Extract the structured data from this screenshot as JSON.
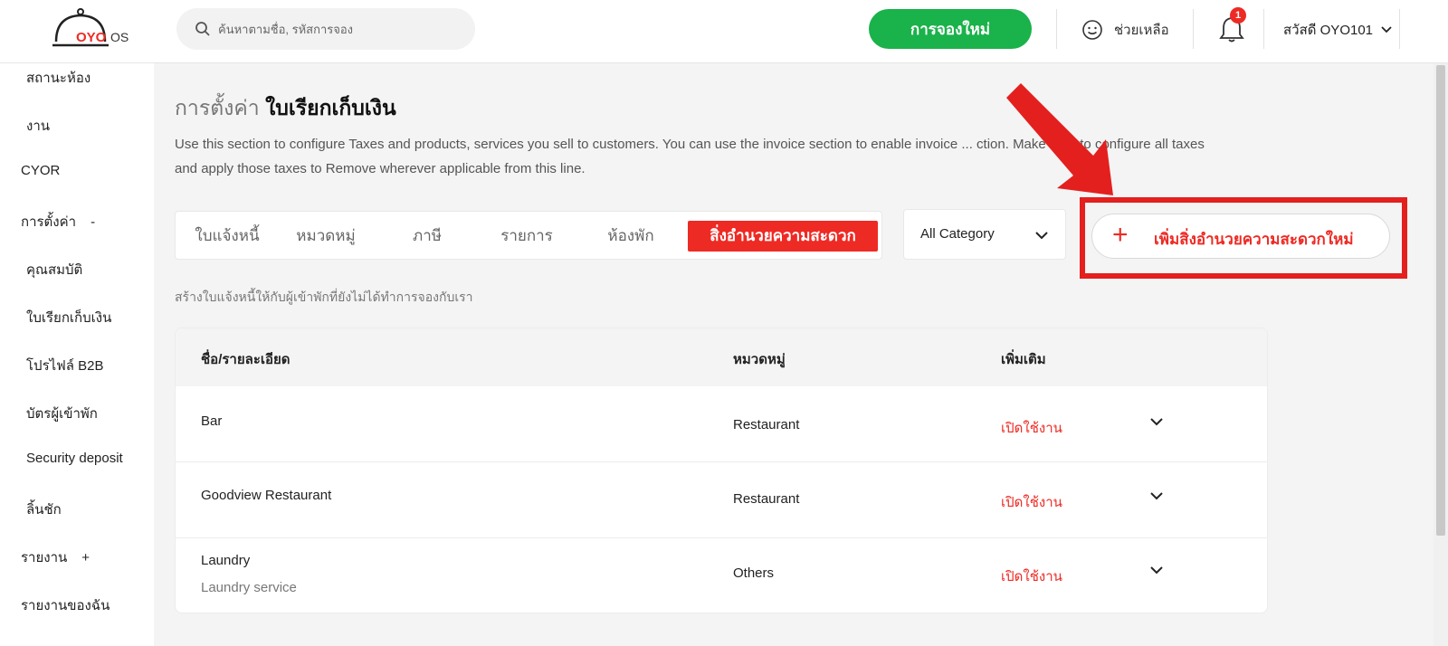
{
  "header": {
    "logo_text": "OYO",
    "logo_suffix": "OS",
    "search_placeholder": "ค้นหาตามชื่อ, รหัสการจอง",
    "new_booking_label": "การจองใหม่",
    "help_label": "ช่วยเหลือ",
    "notification_count": "1",
    "user_greeting": "สวัสดี OYO101"
  },
  "sidebar": {
    "items": [
      {
        "label": "สถานะห้อง"
      },
      {
        "label": "งาน"
      },
      {
        "label": "CYOR"
      },
      {
        "label": "การตั้งค่า",
        "symbol": "-"
      },
      {
        "label": "คุณสมบัติ"
      },
      {
        "label": "ใบเรียกเก็บเงิน"
      },
      {
        "label": "โปรไฟล์ B2B"
      },
      {
        "label": "บัตรผู้เข้าพัก"
      },
      {
        "label": "Security deposit"
      },
      {
        "label": "ลิ้นชัก"
      },
      {
        "label": "รายงาน",
        "symbol": "+"
      },
      {
        "label": "รายงานของฉัน"
      }
    ]
  },
  "page": {
    "title_prefix": "การตั้งค่า",
    "title_main": "ใบเรียกเก็บเงิน",
    "description": "Use this section to configure Taxes and products, services you sell to customers. You can use the invoice section to enable invoice ... ction. Make sure to configure all taxes and apply those taxes to Remove wherever applicable from this line.",
    "subnote": "สร้างใบแจ้งหนี้ให้กับผู้เข้าพักที่ยังไม่ได้ทำการจองกับเรา"
  },
  "tabs": [
    {
      "label": "ใบแจ้งหนี้",
      "active": false
    },
    {
      "label": "หมวดหมู่",
      "active": false
    },
    {
      "label": "ภาษี",
      "active": false
    },
    {
      "label": "รายการ",
      "active": false
    },
    {
      "label": "ห้องพัก",
      "active": false
    },
    {
      "label": "สิ่งอำนวยความสะดวก",
      "active": true
    }
  ],
  "category_select": {
    "value": "All Category"
  },
  "add_button": {
    "label": "เพิ่มสิ่งอำนวยความสะดวกใหม่"
  },
  "table": {
    "headers": [
      "ชื่อ/รายละเอียด",
      "หมวดหมู่",
      "เพิ่มเติม"
    ],
    "rows": [
      {
        "name": "Bar",
        "detail": "",
        "category": "Restaurant",
        "status": "เปิดใช้งาน"
      },
      {
        "name": "Goodview Restaurant",
        "detail": "",
        "category": "Restaurant",
        "status": "เปิดใช้งาน"
      },
      {
        "name": "Laundry",
        "detail": "Laundry service",
        "category": "Others",
        "status": "เปิดใช้งาน"
      }
    ]
  },
  "colors": {
    "brand_red": "#ee2a24",
    "green": "#1ab24a",
    "highlight_red": "#e3201e"
  },
  "icons": [
    "search-icon",
    "help-face-icon",
    "bell-icon",
    "chevron-down-icon",
    "plus-icon",
    "arrow-annotation"
  ]
}
